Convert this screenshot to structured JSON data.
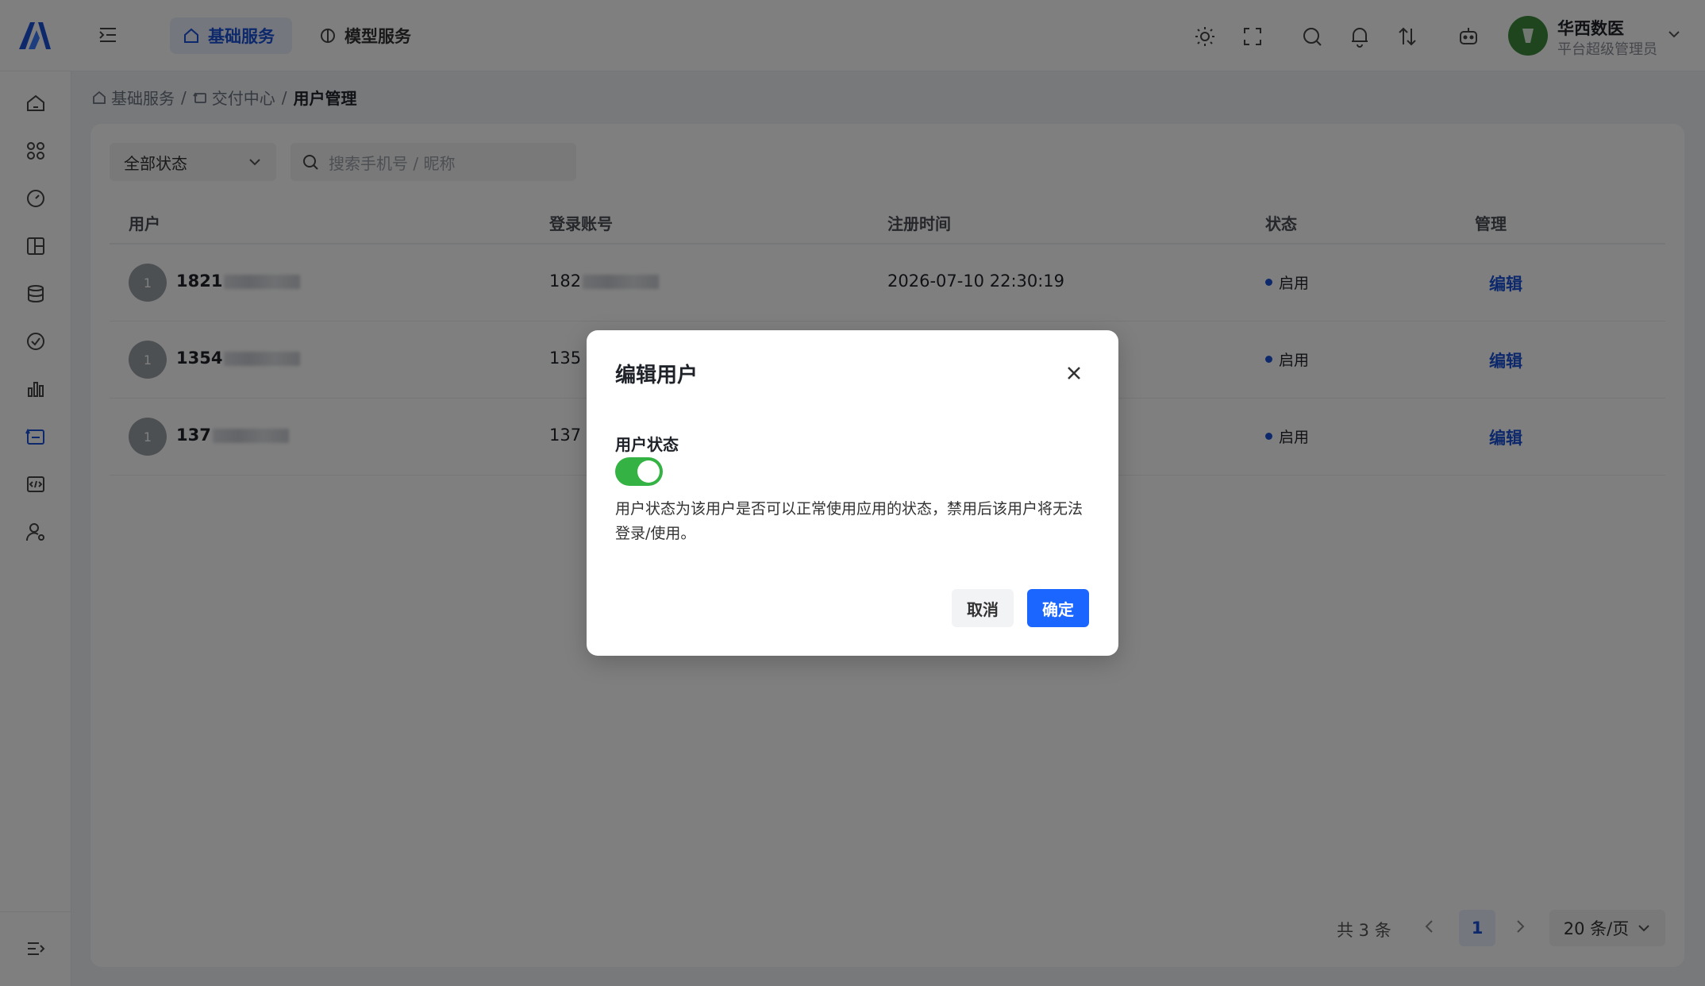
{
  "header": {
    "tabs": [
      {
        "label": "基础服务",
        "active": true
      },
      {
        "label": "模型服务",
        "active": false
      }
    ],
    "user": {
      "name": "华西数医",
      "role": "平台超级管理员"
    },
    "icons": [
      "sun-icon",
      "fullscreen-icon",
      "search-icon",
      "bell-icon",
      "transfer-icon",
      "robot-icon"
    ]
  },
  "sidebar": {
    "icons": [
      "home-icon",
      "apps-icon",
      "dashboard-icon",
      "layout-icon",
      "database-icon",
      "check-circle-icon",
      "bar-chart-icon",
      "delivery-icon",
      "code-icon",
      "user-settings-icon"
    ],
    "active_index": 7
  },
  "breadcrumb": {
    "items": [
      "基础服务",
      "交付中心",
      "用户管理"
    ],
    "separator": "/"
  },
  "filters": {
    "status_select": "全部状态",
    "search_placeholder": "搜索手机号 / 昵称"
  },
  "table": {
    "headers": [
      "用户",
      "登录账号",
      "注册时间",
      "状态",
      "管理"
    ],
    "rows": [
      {
        "avatar": "1",
        "user": "1821",
        "account": "182",
        "registered": "2026-07-10 22:30:19",
        "status": "启用",
        "action": "编辑"
      },
      {
        "avatar": "1",
        "user": "1354",
        "account": "135",
        "registered": "",
        "status": "启用",
        "action": "编辑"
      },
      {
        "avatar": "1",
        "user": "137",
        "account": "137",
        "registered": "",
        "status": "启用",
        "action": "编辑"
      }
    ]
  },
  "pagination": {
    "total": "共 3 条",
    "current_page": "1",
    "page_size": "20 条/页"
  },
  "modal": {
    "title": "编辑用户",
    "field_label": "用户状态",
    "toggle_on": true,
    "hint": "用户状态为该用户是否可以正常使用应用的状态，禁用后该用户将无法登录/使用。",
    "cancel_label": "取消",
    "ok_label": "确定"
  },
  "colors": {
    "accent": "#1a52d6",
    "primary_button": "#1a66ff",
    "toggle_on": "#34b244"
  }
}
